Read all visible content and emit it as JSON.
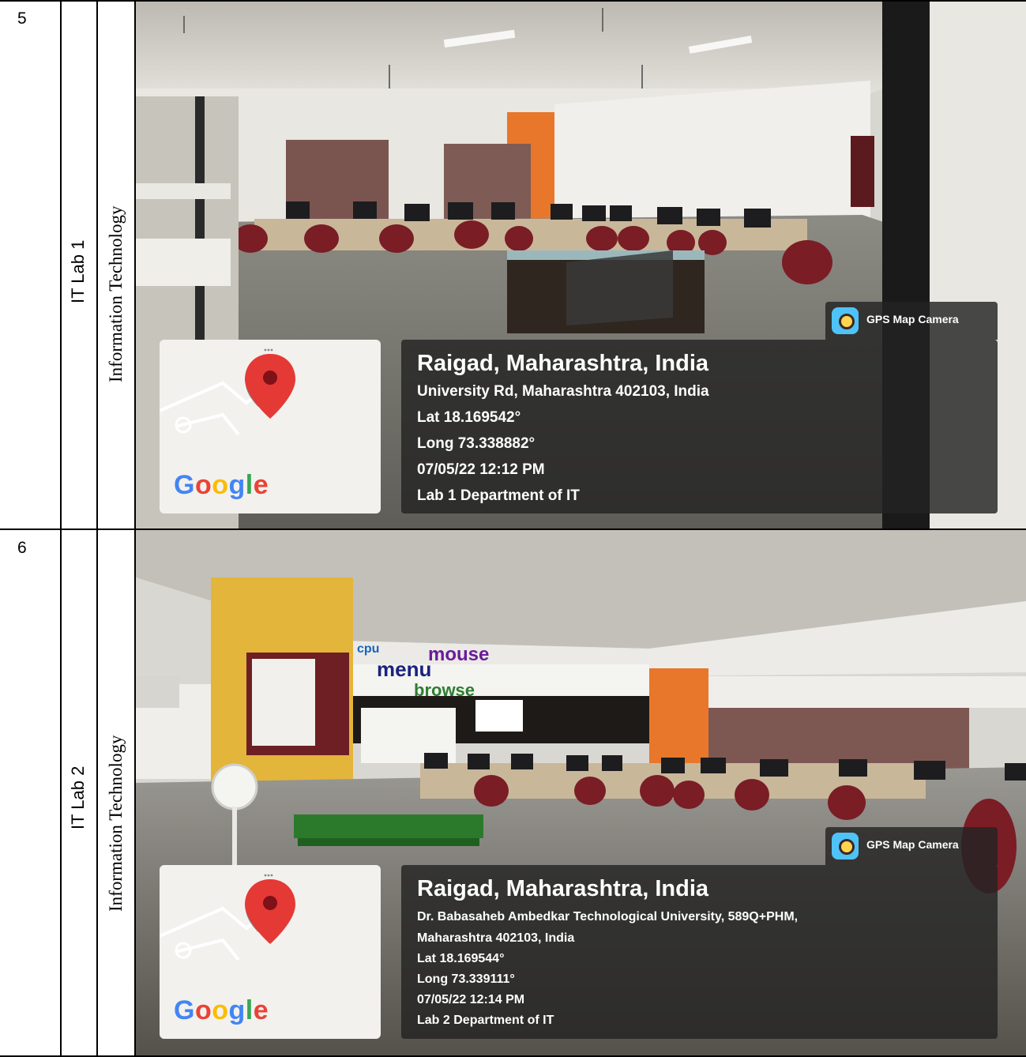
{
  "rows": [
    {
      "number": "5",
      "lab": "IT Lab 1",
      "department": "Information Technology",
      "stamp": {
        "app_label": "GPS Map Camera",
        "place": "Raigad, Maharashtra, India",
        "address": "University Rd, Maharashtra 402103, India",
        "lat": "Lat 18.169542°",
        "long": "Long 73.338882°",
        "datetime": "07/05/22 12:12 PM",
        "note": "Lab 1 Department of IT",
        "map_brand": "Google"
      }
    },
    {
      "number": "6",
      "lab": "IT Lab 2",
      "department": "Information Technology",
      "stamp": {
        "app_label": "GPS Map Camera",
        "place": "Raigad, Maharashtra, India",
        "address": "Dr. Babasaheb Ambedkar Technological University, 589Q+PHM,",
        "address2": "Maharashtra 402103, India",
        "lat": "Lat 18.169544°",
        "long": "Long 73.339111°",
        "datetime": "07/05/22 12:14 PM",
        "note": "Lab 2 Department of IT",
        "map_brand": "Google"
      },
      "wall_words": [
        "menu",
        "mouse",
        "browse",
        "cpu"
      ]
    }
  ],
  "colors": {
    "google_blue": "#4285F4",
    "google_red": "#EA4335",
    "google_yellow": "#FBBC05",
    "google_green": "#34A853",
    "pin_red": "#E53935"
  }
}
